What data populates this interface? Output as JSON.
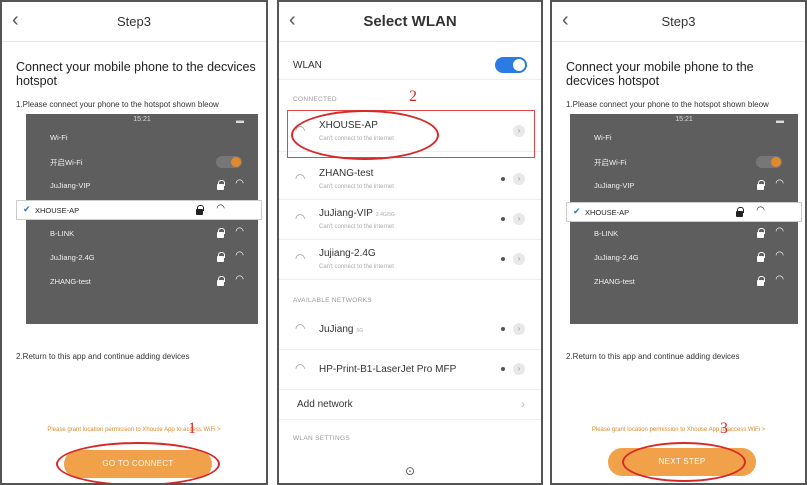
{
  "colors": {
    "accent": "#f0a14a",
    "annotation": "#d62a2a",
    "toggle_on": "#2c7be5",
    "checkmark": "#2a76d2"
  },
  "icons": {
    "back": "chevron-left-icon",
    "wifi": "wifi-icon",
    "lock": "lock-icon",
    "info": "info-icon",
    "chevron": "chevron-right-icon",
    "gear": "settings-icon"
  },
  "screen1": {
    "title": "Step3",
    "heading": "Connect your mobile phone to the decvices hotspot",
    "step1": "1.Please connect your phone to the hotspot shown bleow",
    "phone": {
      "time": "15:21",
      "rows": [
        "Wi-Fi",
        "开启Wi-Fi",
        "JuJiang-VIP",
        "XHOUSE-AP",
        "B-LINK",
        "JuJiang-2.4G",
        "ZHANG-test"
      ]
    },
    "step2": "2.Return to this app and continue adding devices",
    "permission": "Please grant location permission to Xhouse App to access WiFi >",
    "button": "GO TO CONNECT",
    "annotation": "1"
  },
  "screen2": {
    "title": "Select WLAN",
    "wlan_label": "WLAN",
    "connected_section": "CONNECTED",
    "annotation": "2",
    "connected_networks": [
      {
        "name": "XHOUSE-AP",
        "status": "Can't connect to the internet"
      },
      {
        "name": "ZHANG-test",
        "status": "Can't connect to the internet"
      },
      {
        "name": "JuJiang-VIP",
        "tag": "2.4G/5G",
        "status": "Can't connect to the internet"
      },
      {
        "name": "Jujiang-2.4G",
        "status": "Can't connect to the internet"
      }
    ],
    "available_section": "AVAILABLE NETWORKS",
    "available_networks": [
      {
        "name": "JuJiang",
        "tag": "5G"
      },
      {
        "name": "HP-Print-B1-LaserJet Pro MFP"
      }
    ],
    "add_network": "Add network",
    "settings_section": "WLAN SETTINGS"
  },
  "screen3": {
    "title": "Step3",
    "heading": "Connect your mobile phone to the decvices hotspot",
    "step1": "1.Please connect your phone to the hotspot shown bleow",
    "phone": {
      "time": "15:21",
      "rows": [
        "Wi-Fi",
        "开启Wi-Fi",
        "JuJiang-VIP",
        "XHOUSE-AP",
        "B-LINK",
        "JuJiang-2.4G",
        "ZHANG-test"
      ]
    },
    "step2": "2.Return to this app and continue adding devices",
    "permission": "Please grant location permission to Xhouse App to access WiFi >",
    "button": "NEXT STEP",
    "annotation": "3"
  }
}
